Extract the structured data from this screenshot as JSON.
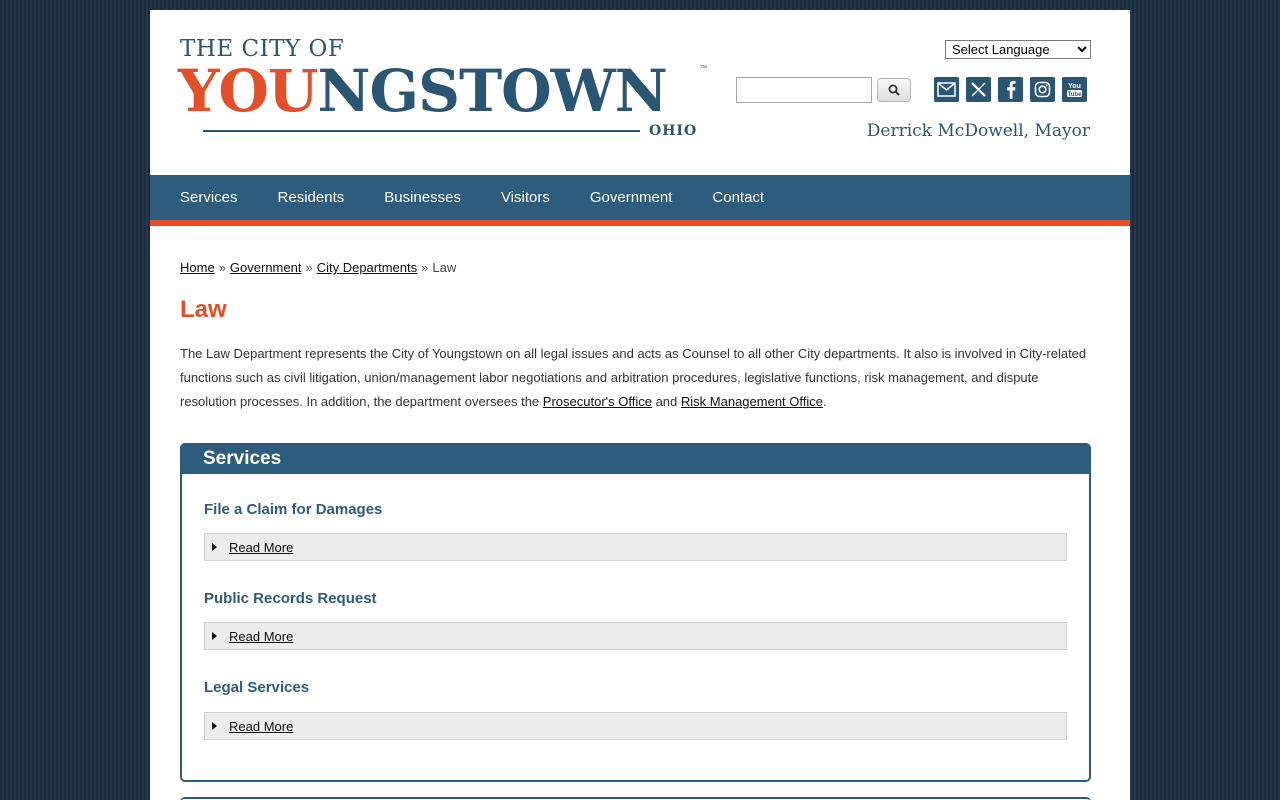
{
  "header": {
    "logo": {
      "line1": "THE CITY OF",
      "you": "YOU",
      "ngstown": "NGSTOWN",
      "tm": "™",
      "ohio": "OHIO"
    },
    "language_select": {
      "selected": "Select Language"
    },
    "search": {
      "value": "",
      "button_icon": "search-icon"
    },
    "social_icons": [
      "email-icon",
      "x-twitter-icon",
      "facebook-icon",
      "instagram-icon",
      "youtube-icon"
    ],
    "mayor": "Derrick McDowell, Mayor"
  },
  "nav": {
    "items": [
      "Services",
      "Residents",
      "Businesses",
      "Visitors",
      "Government",
      "Contact"
    ]
  },
  "breadcrumb": {
    "items": [
      "Home",
      "Government",
      "City Departments"
    ],
    "current": "Law",
    "separator": "»"
  },
  "main": {
    "title": "Law",
    "intro": {
      "text_before": "The Law Department represents the City of Youngstown on all legal issues and acts as Counsel to all other City departments. It also is involved in City-related functions such as civil litigation, union/management labor negotiations and arbitration procedures, legislative functions, risk management, and dispute resolution processes. In addition, the department oversees the ",
      "link1": "Prosecutor's Office",
      "text_middle": " and ",
      "link2": "Risk Management Office",
      "text_after": "."
    },
    "services": {
      "heading": "Services",
      "items": [
        {
          "title": "File a Claim for Damages",
          "read_more": "Read More"
        },
        {
          "title": "Public Records Request",
          "read_more": "Read More"
        },
        {
          "title": "Legal Services",
          "read_more": "Read More"
        }
      ]
    }
  },
  "colors": {
    "brand_blue": "#2e5c7d",
    "brand_orange": "#e2502a",
    "background": "#1e3142"
  }
}
